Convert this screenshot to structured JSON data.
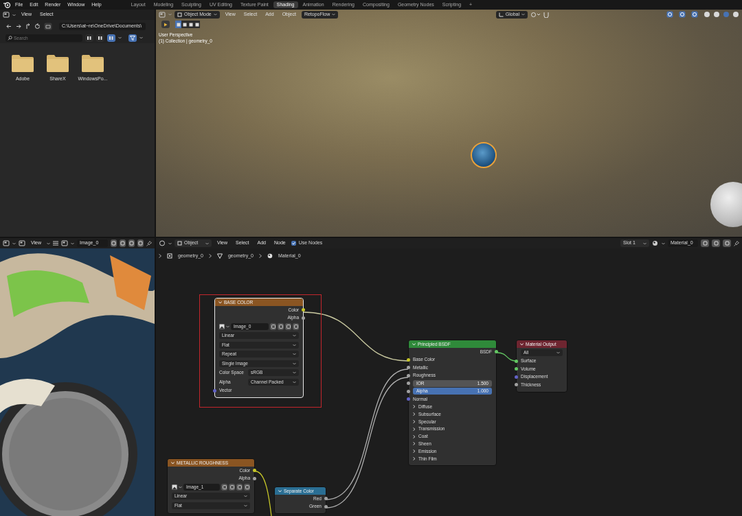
{
  "topbar": {
    "menus": [
      "File",
      "Edit",
      "Render",
      "Window",
      "Help"
    ],
    "workspaces": [
      {
        "label": "Layout",
        "selected": false
      },
      {
        "label": "Modeling",
        "selected": false
      },
      {
        "label": "Sculpting",
        "selected": false
      },
      {
        "label": "UV Editing",
        "selected": false
      },
      {
        "label": "Texture Paint",
        "selected": false
      },
      {
        "label": "Shading",
        "selected": true
      },
      {
        "label": "Animation",
        "selected": false
      },
      {
        "label": "Rendering",
        "selected": false
      },
      {
        "label": "Compositing",
        "selected": false
      },
      {
        "label": "Geometry Nodes",
        "selected": false
      },
      {
        "label": "Scripting",
        "selected": false
      }
    ],
    "add_tab": "+"
  },
  "file_browser": {
    "menus": [
      "View",
      "Select"
    ],
    "path": "C:\\Users\\at~re\\OneDrive\\Documents\\",
    "search": {
      "placeholder": "Search"
    },
    "folders": [
      "Adobe",
      "ShareX",
      "WindowsPo..."
    ]
  },
  "viewport": {
    "mode": "Object Mode",
    "menus": [
      "View",
      "Select",
      "Add",
      "Object"
    ],
    "addon": "RetopoFlow",
    "orientation": "Global",
    "overlay_lines": [
      "User Perspective",
      "(1) Collection | geometry_0"
    ]
  },
  "image_editor": {
    "menu": "View",
    "image": "Image_0"
  },
  "node_editor": {
    "object_type": "Object",
    "menus": [
      "View",
      "Select",
      "Add",
      "Node"
    ],
    "use_nodes": {
      "label": "Use Nodes",
      "checked": true
    },
    "slot": "Slot 1",
    "material": "Material_0",
    "breadcrumbs": [
      "geometry_0",
      "geometry_0",
      "Material_0"
    ],
    "nodes": [
      {
        "title": "BASE COLOR",
        "color": "#8a5522",
        "selected": true,
        "rows": [
          {
            "kind": "output",
            "label": "Color",
            "color": "#c7c729"
          },
          {
            "kind": "output",
            "label": "Alpha",
            "color": "#a1a1a1"
          },
          {
            "kind": "image",
            "value": "Image_0"
          },
          {
            "kind": "dropdown",
            "value": "Linear"
          },
          {
            "kind": "dropdown",
            "value": "Flat"
          },
          {
            "kind": "dropdown",
            "value": "Repeat"
          },
          {
            "kind": "dropdown",
            "value": "Single Image"
          },
          {
            "kind": "property",
            "label": "Color Space",
            "value": "sRGB"
          },
          {
            "kind": "property",
            "label": "Alpha",
            "value": "Channel Packed"
          },
          {
            "kind": "input",
            "label": "Vector",
            "color": "#6363c7"
          }
        ]
      },
      {
        "title": "Principled BSDF",
        "color": "#2f8a3a",
        "selected": false,
        "rows": [
          {
            "kind": "output",
            "label": "BSDF",
            "color": "#63c763"
          },
          {
            "kind": "input",
            "label": "Base Color",
            "color": "#c7c729"
          },
          {
            "kind": "input",
            "label": "Metallic",
            "color": "#a1a1a1"
          },
          {
            "kind": "input",
            "label": "Roughness",
            "color": "#a1a1a1"
          },
          {
            "kind": "number",
            "label": "IOR",
            "value": "1.500",
            "color": "#a1a1a1"
          },
          {
            "kind": "slider",
            "label": "Alpha",
            "value": "1.000",
            "level": 1,
            "color": "#a1a1a1"
          },
          {
            "kind": "input",
            "label": "Normal",
            "color": "#6363c7"
          },
          {
            "kind": "panel",
            "label": "Diffuse",
            "expanded": false
          },
          {
            "kind": "panel",
            "label": "Subsurface",
            "expanded": false
          },
          {
            "kind": "panel",
            "label": "Specular",
            "expanded": false
          },
          {
            "kind": "panel",
            "label": "Transmission",
            "expanded": false
          },
          {
            "kind": "panel",
            "label": "Coat",
            "expanded": false
          },
          {
            "kind": "panel",
            "label": "Sheen",
            "expanded": false
          },
          {
            "kind": "panel",
            "label": "Emission",
            "expanded": false
          },
          {
            "kind": "panel",
            "label": "Thin Film",
            "expanded": false
          }
        ]
      },
      {
        "title": "Material Output",
        "color": "#6e2530",
        "selected": false,
        "rows": [
          {
            "kind": "dropdown",
            "value": "All"
          },
          {
            "kind": "input",
            "label": "Surface",
            "color": "#63c763"
          },
          {
            "kind": "input",
            "label": "Volume",
            "color": "#63c763"
          },
          {
            "kind": "input",
            "label": "Displacement",
            "color": "#6363c7"
          },
          {
            "kind": "input",
            "label": "Thickness",
            "color": "#a1a1a1"
          }
        ]
      },
      {
        "title": "METALLIC ROUGHNESS",
        "color": "#8a5522",
        "selected": false,
        "rows": [
          {
            "kind": "output",
            "label": "Color",
            "color": "#c7c729"
          },
          {
            "kind": "output",
            "label": "Alpha",
            "color": "#a1a1a1"
          },
          {
            "kind": "image",
            "value": "Image_1"
          },
          {
            "kind": "dropdown",
            "value": "Linear"
          },
          {
            "kind": "dropdown",
            "value": "Flat"
          }
        ]
      },
      {
        "title": "Separate Color",
        "color": "#2a6e93",
        "selected": false,
        "rows": [
          {
            "kind": "output",
            "label": "Red",
            "color": "#a1a1a1"
          },
          {
            "kind": "output",
            "label": "Green",
            "color": "#a1a1a1"
          }
        ]
      }
    ]
  }
}
